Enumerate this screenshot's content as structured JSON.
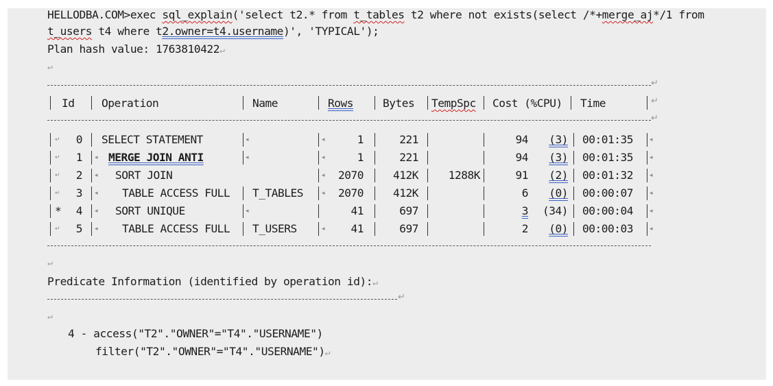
{
  "sql": {
    "prompt": "HELLODBA.COM>",
    "cmd_exec": "exec ",
    "cmd_fn": "sql_explain",
    "cmd_open": "('select t2.* from ",
    "cmd_table1": "t_tables",
    "cmd_mid1": " t2 where not exists(select /*+",
    "cmd_hint": "merge_aj",
    "cmd_mid2": "*/1 from",
    "line2_table": "t_users",
    "line2_mid": " t4 where t",
    "line2_pred": "2.owner=t4.username",
    "line2_end": ")', 'TYPICAL');"
  },
  "plan_hash": "Plan hash value: 1763810422",
  "headers": {
    "id": "Id",
    "operation": "Operation",
    "name": "Name",
    "rows": "Rows",
    "bytes": "Bytes",
    "tempspc": "TempSpc",
    "cost": "Cost (%CPU)",
    "time": "Time"
  },
  "rows": [
    {
      "mark": "",
      "id": "0",
      "operation": "SELECT STATEMENT",
      "name": "",
      "rows": "1",
      "bytes": "221",
      "tempspc": "",
      "cost": "94",
      "cpu": "(3)",
      "time": "00:01:35"
    },
    {
      "mark": "",
      "id": "1",
      "operation": "MERGE JOIN ANTI",
      "name": "",
      "rows": "1",
      "bytes": "221",
      "tempspc": "",
      "cost": "94",
      "cpu": "(3)",
      "time": "00:01:35"
    },
    {
      "mark": "",
      "id": "2",
      "operation": "SORT JOIN",
      "name": "",
      "rows": "2070",
      "bytes": "412K",
      "tempspc": "1288K",
      "cost": "91",
      "cpu": "(2)",
      "time": "00:01:32"
    },
    {
      "mark": "",
      "id": "3",
      "operation": "TABLE ACCESS FULL",
      "name": "T_TABLES",
      "rows": "2070",
      "bytes": "412K",
      "tempspc": "",
      "cost": "6",
      "cpu": "(0)",
      "time": "00:00:07"
    },
    {
      "mark": "*",
      "id": "4",
      "operation": "SORT UNIQUE",
      "name": "",
      "rows": "41",
      "bytes": "697",
      "tempspc": "",
      "cost": "3",
      "cpu": "(34)",
      "time": "00:00:04"
    },
    {
      "mark": "",
      "id": "5",
      "operation": "TABLE ACCESS FULL",
      "name": "T_USERS",
      "rows": "41",
      "bytes": "697",
      "tempspc": "",
      "cost": "2",
      "cpu": "(0)",
      "time": "00:00:03"
    }
  ],
  "predicate_title": "Predicate Information (identified by operation id):",
  "predicates": {
    "line1": "4 - access(\"T2\".\"OWNER\"=\"T4\".\"USERNAME\")",
    "line2": "filter(\"T2\".\"OWNER\"=\"T4\".\"USERNAME\")"
  },
  "colors": {
    "paper": "#ededed",
    "text": "#1c1c1c",
    "spell_wavy": "#d02020",
    "grammar_double": "#3a5fbf"
  }
}
